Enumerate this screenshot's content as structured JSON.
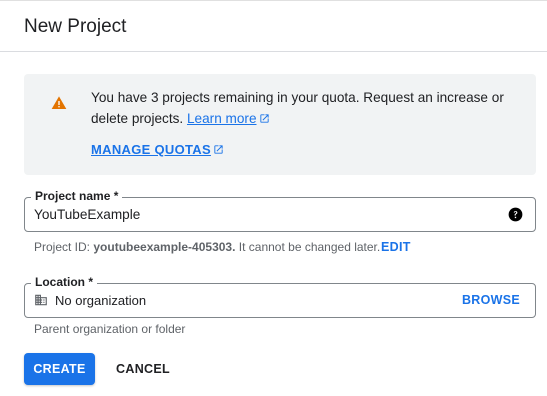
{
  "dialog": {
    "title": "New Project"
  },
  "quota_notice": {
    "message_before_link": "You have 3 projects remaining in your quota. Request an increase or delete projects.",
    "learn_more_label": "Learn more",
    "manage_quotas_label": "MANAGE QUOTAS",
    "warning_color": "#e37400",
    "icons": [
      "warning-icon",
      "external-link-icon"
    ]
  },
  "project_name": {
    "label": "Project name *",
    "value": "YouTubeExample",
    "help_icon": "help-icon"
  },
  "project_id": {
    "prefix": "Project ID:",
    "id": "youtubeexample-405303.",
    "suffix": "It cannot be changed later.",
    "edit_label": "EDIT"
  },
  "location": {
    "label": "Location *",
    "value": "No organization",
    "icon": "building-icon",
    "browse_label": "BROWSE",
    "hint": "Parent organization or folder"
  },
  "actions": {
    "create_label": "CREATE",
    "cancel_label": "CANCEL"
  },
  "colors": {
    "accent": "#1a73e8",
    "panel_bg": "#f1f3f4"
  }
}
